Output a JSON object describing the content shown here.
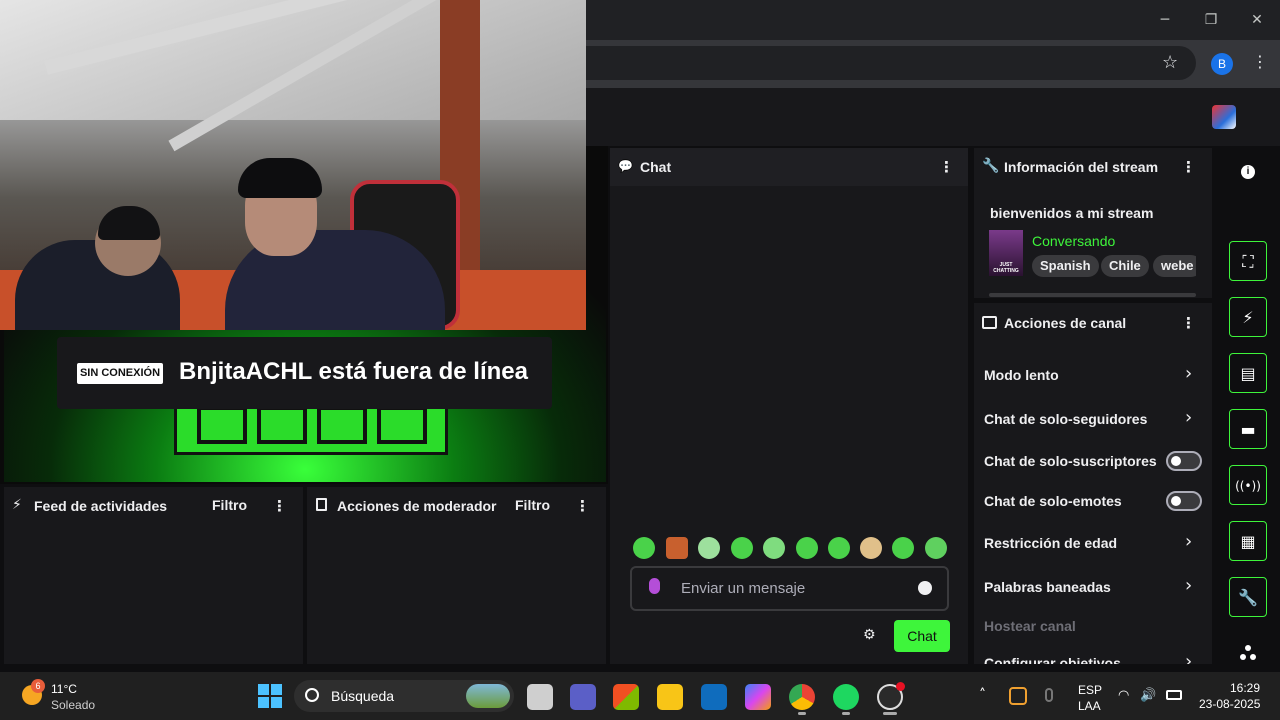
{
  "browser": {
    "profile_initial": "B"
  },
  "video": {
    "offline_badge": "SIN CONEXIÓN",
    "offline_message": "BnjitaACHL está fuera de línea"
  },
  "activity_feed": {
    "title": "Feed de actividades",
    "filter": "Filtro"
  },
  "mod_actions": {
    "title": "Acciones de moderador",
    "filter": "Filtro"
  },
  "chat": {
    "title": "Chat",
    "placeholder": "Enviar un mensaje",
    "send_label": "Chat"
  },
  "stream_info": {
    "title": "Información del stream",
    "stream_title": "bienvenidos a mi stream",
    "category": "Conversando",
    "box_art_text": "JUST CHATTING",
    "tags": [
      "Spanish",
      "Chile",
      "webe"
    ]
  },
  "channel_actions": {
    "title": "Acciones de canal",
    "items": [
      {
        "label": "Modo lento",
        "control": "chevron"
      },
      {
        "label": "Chat de solo-seguidores",
        "control": "chevron"
      },
      {
        "label": "Chat de solo-suscriptores",
        "control": "toggle",
        "enabled": false
      },
      {
        "label": "Chat de solo-emotes",
        "control": "toggle",
        "enabled": false
      },
      {
        "label": "Restricción de edad",
        "control": "chevron"
      },
      {
        "label": "Palabras baneadas",
        "control": "chevron"
      },
      {
        "label": "Hostear canal",
        "control": "none",
        "disabled": true
      },
      {
        "label": "Configurar objetivos",
        "control": "chevron"
      }
    ]
  },
  "colors": {
    "accent": "#3ef53b",
    "panel": "#18181b",
    "background": "#0e0e10",
    "category": "#3ef53b"
  },
  "taskbar": {
    "weather_badge": "6",
    "temperature": "11°C",
    "weather": "Soleado",
    "search_placeholder": "Búsqueda",
    "language": "ESP",
    "layout": "LAA",
    "time": "16:29",
    "date": "23-08-2025"
  },
  "icons": {
    "rail": [
      "info-icon",
      "screenshot-icon",
      "lightning-icon",
      "notes-icon",
      "chat-bubble-icon",
      "broadcast-icon",
      "layout-icon",
      "wrench-icon",
      "more-icon"
    ]
  }
}
